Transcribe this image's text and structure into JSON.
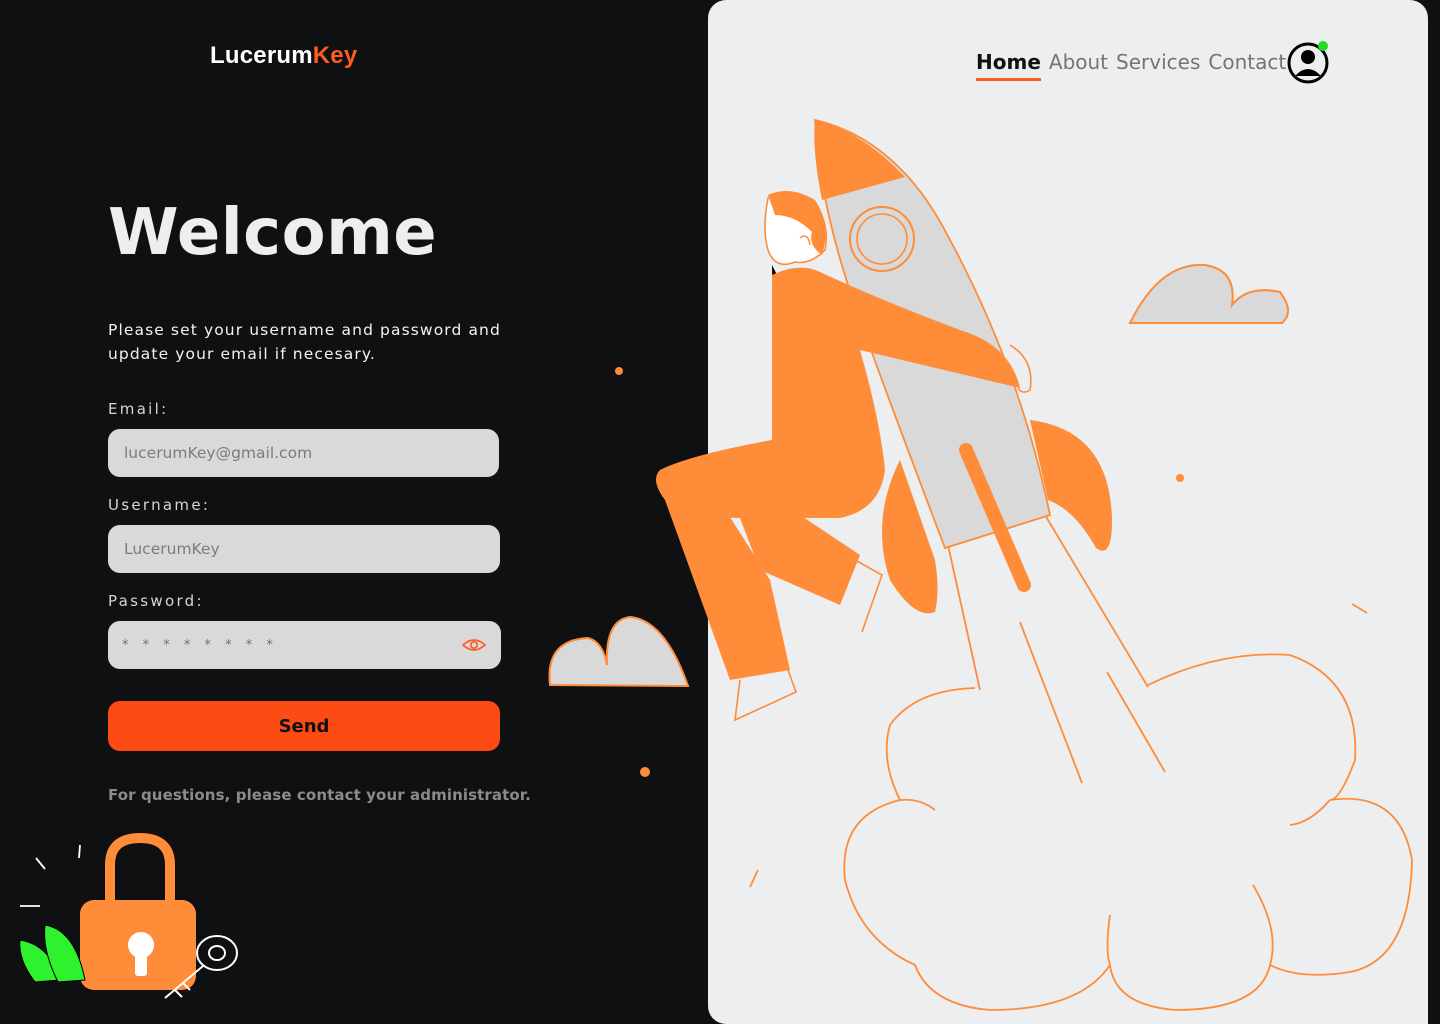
{
  "brand": {
    "name_main": "Lucerum",
    "name_accent": "Key"
  },
  "hero": {
    "title": "Welcome",
    "intro": "Please set your  username and password and update your email if necesary."
  },
  "form": {
    "email": {
      "label": "Email:",
      "placeholder": "lucerumKey@gmail.com"
    },
    "username": {
      "label": "Username:",
      "placeholder": "LucerumKey"
    },
    "password": {
      "label": "Password:",
      "mask": "* * * * * * * *"
    },
    "submit_label": "Send",
    "help_text": "For questions, please contact your administrator."
  },
  "nav": {
    "items": [
      {
        "label": "Home",
        "active": true
      },
      {
        "label": "About",
        "active": false
      },
      {
        "label": "Services",
        "active": false
      },
      {
        "label": "Contact",
        "active": false
      }
    ]
  },
  "icons": {
    "avatar": "user-avatar-icon",
    "status_dot": "online-status-dot",
    "eye": "eye-icon",
    "lock": "padlock-icon",
    "key": "key-icon"
  },
  "colors": {
    "background": "#0f1012",
    "panel": "#edeef0",
    "accent": "#fc4b13",
    "illustration_orange": "#ff8c38",
    "status": "#22dd22"
  }
}
